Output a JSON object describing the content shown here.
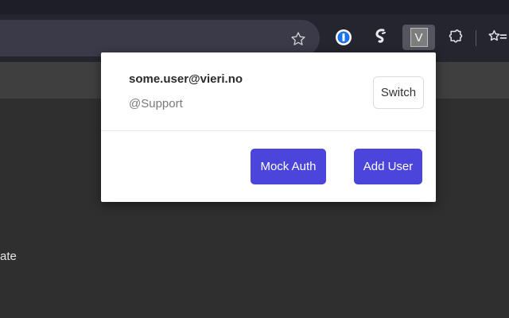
{
  "popup": {
    "email": "some.user@vieri.no",
    "role": "@Support",
    "switch_label": "Switch",
    "mock_auth_label": "Mock Auth",
    "add_user_label": "Add User"
  },
  "toolbar": {
    "extension_v_letter": "V"
  },
  "page": {
    "partial_text": "ate"
  },
  "colors": {
    "accent": "#4b45db",
    "toolbar": "#25252f",
    "page_background": "#2f2f2f"
  },
  "icons": [
    "star-icon",
    "onepassword-icon",
    "svelte-icon",
    "vieri-extension-icon",
    "extensions-puzzle-icon",
    "bookmarks-icon"
  ]
}
